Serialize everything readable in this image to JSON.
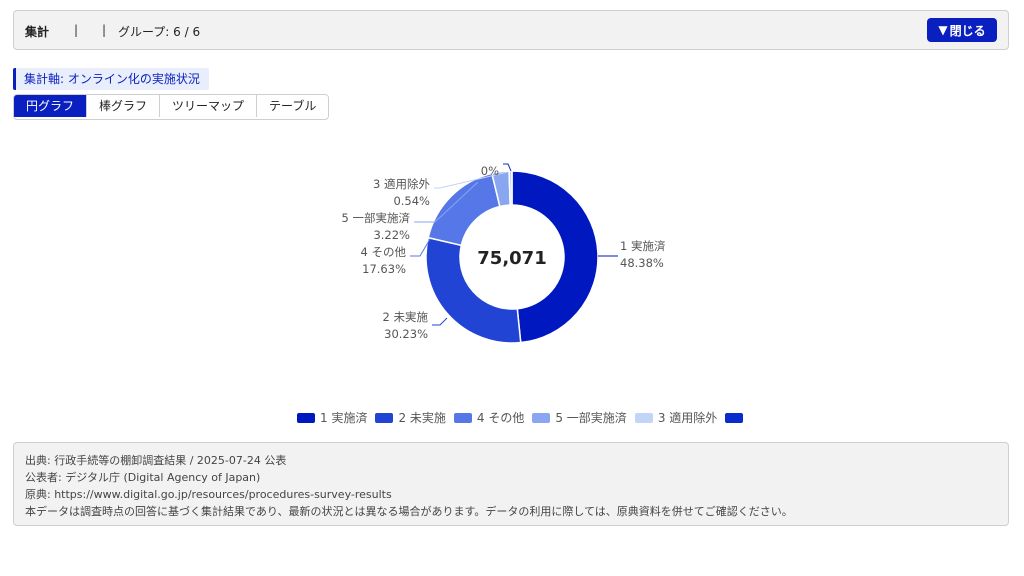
{
  "header": {
    "title": "集計",
    "sep1": "|",
    "sep2": "|",
    "groups": "グループ: 6 / 6",
    "close_label": "閉じる"
  },
  "axis_label": "集計軸: オンライン化の実施状況",
  "tabs": [
    {
      "label": "円グラフ",
      "active": true
    },
    {
      "label": "棒グラフ",
      "active": false
    },
    {
      "label": "ツリーマップ",
      "active": false
    },
    {
      "label": "テーブル",
      "active": false
    }
  ],
  "chart_data": {
    "type": "pie",
    "donut": true,
    "center_label": "75,071",
    "slices": [
      {
        "name": "1 実施済",
        "percent_label": "48.38%",
        "value": 48.38,
        "color": "#0018c0"
      },
      {
        "name": "2 未実施",
        "percent_label": "30.23%",
        "value": 30.23,
        "color": "#2244d4"
      },
      {
        "name": "4 その他",
        "percent_label": "17.63%",
        "value": 17.63,
        "color": "#5577e8"
      },
      {
        "name": "5 一部実施済",
        "percent_label": "3.22%",
        "value": 3.22,
        "color": "#8aa6f0"
      },
      {
        "name": "3 適用除外",
        "percent_label": "0.54%",
        "value": 0.54,
        "color": "#c2d4f8"
      },
      {
        "name": "",
        "percent_label": "0%",
        "value": 0.0,
        "color": "#0a2ccc"
      }
    ],
    "legend_placement": "bottom"
  },
  "footer": {
    "source": "出典: 行政手続等の棚卸調査結果 / 2025-07-24 公表",
    "publisher": "公表者: デジタル庁 (Digital Agency of Japan)",
    "original": "原典: https://www.digital.go.jp/resources/procedures-survey-results",
    "disclaimer": "本データは調査時点の回答に基づく集計結果であり、最新の状況とは異なる場合があります。データの利用に際しては、原典資料を併せてご確認ください。"
  }
}
